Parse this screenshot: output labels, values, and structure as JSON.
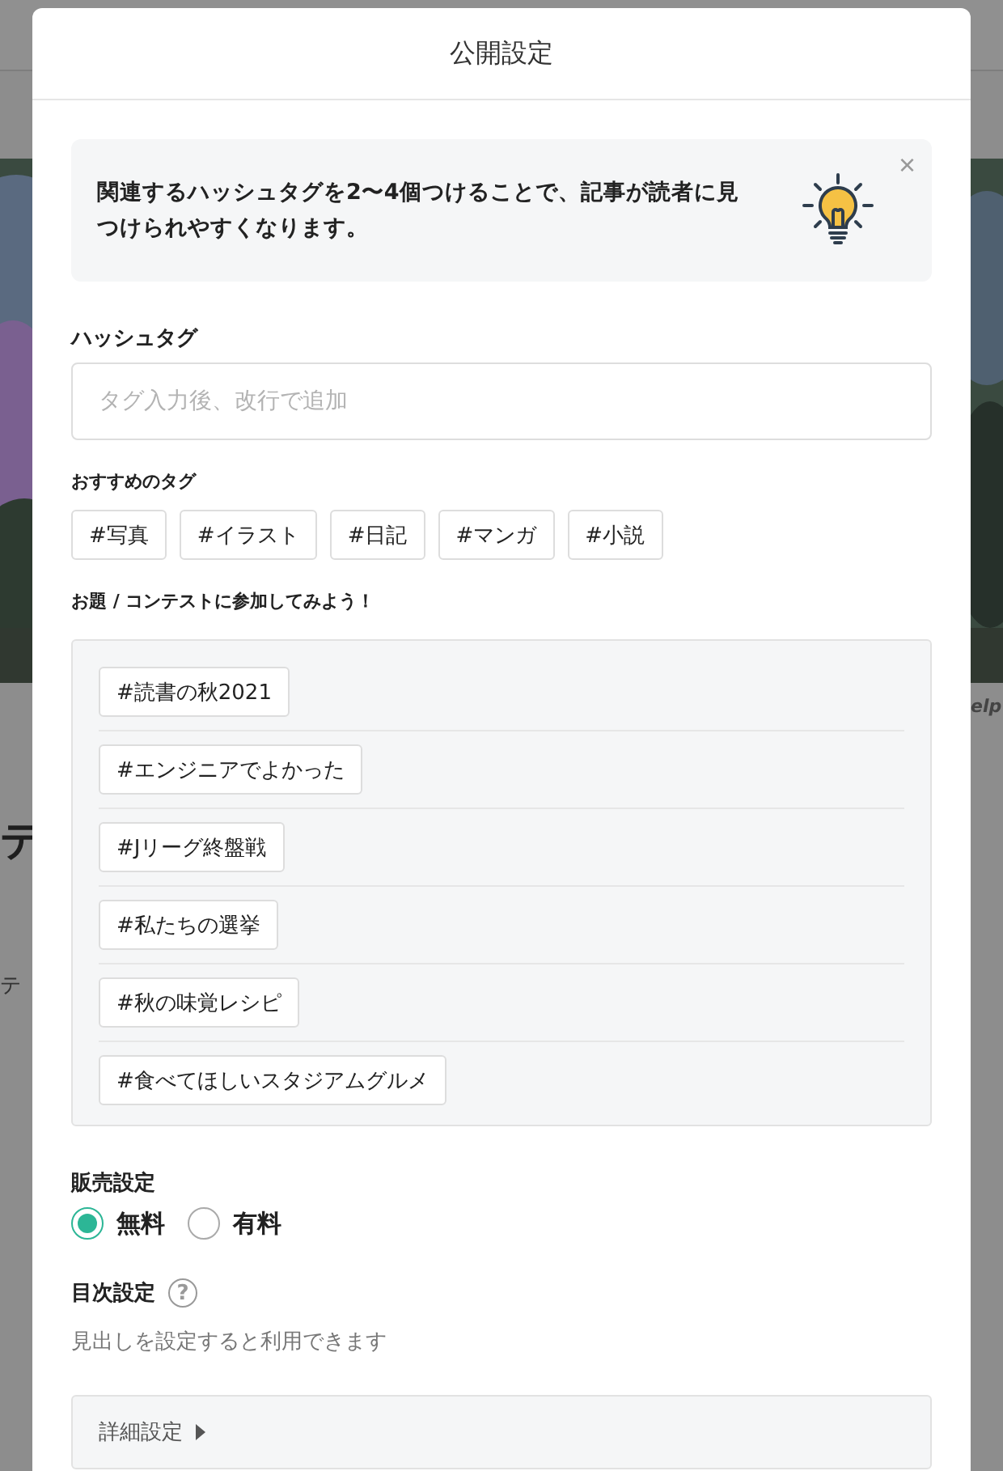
{
  "background": {
    "heading_fragment": "テ",
    "text_fragment": "テ",
    "caption_fragment": "elp"
  },
  "dialog": {
    "title": "公開設定"
  },
  "tip": {
    "text": "関連するハッシュタグを2〜4個つけることで、記事が読者に見つけられやすくなります。",
    "close": "×"
  },
  "hashtag": {
    "label": "ハッシュタグ",
    "placeholder": "タグ入力後、改行で追加"
  },
  "recommended": {
    "label": "おすすめのタグ",
    "tags": [
      "#写真",
      "#イラスト",
      "#日記",
      "#マンガ",
      "#小説"
    ]
  },
  "contests": {
    "label": "お題 / コンテストに参加してみよう！",
    "tags": [
      "#読書の秋2021",
      "#エンジニアでよかった",
      "#Jリーグ終盤戦",
      "#私たちの選挙",
      "#秋の味覚レシピ",
      "#食べてほしいスタジアムグルメ"
    ]
  },
  "sales": {
    "label": "販売設定",
    "options": [
      {
        "label": "無料",
        "selected": true
      },
      {
        "label": "有料",
        "selected": false
      }
    ]
  },
  "toc": {
    "label": "目次設定",
    "help": "?",
    "note": "見出しを設定すると利用できます"
  },
  "advanced": {
    "label": "詳細設定",
    "expanded": false
  }
}
